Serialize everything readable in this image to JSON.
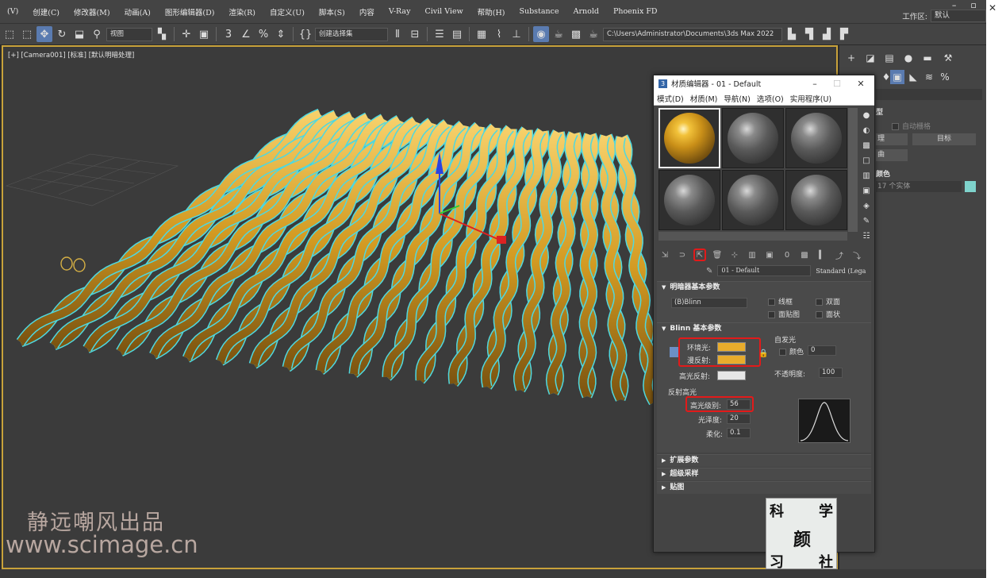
{
  "menubar": {
    "items": [
      "(V)",
      "创建(C)",
      "修改器(M)",
      "动画(A)",
      "图形编辑器(D)",
      "渲染(R)",
      "自定义(U)",
      "脚本(S)",
      "内容",
      "V-Ray",
      "Civil View",
      "帮助(H)",
      "Substance",
      "Arnold",
      "Phoenix FD"
    ],
    "workspace_label": "工作区:",
    "workspace_value": "默认"
  },
  "toolbar": {
    "view_dropdown": "视图",
    "selection_set_dropdown": "创建选择集",
    "path_dropdown": "C:\\Users\\Administrator\\Documents\\3ds Max 2022"
  },
  "viewport": {
    "label": "[+] [Camera001] [标准] [默认明暗处理]"
  },
  "command_panel": {
    "label_section": "型",
    "auto_grid": "自动栅格",
    "row1": "理",
    "target_button": "目标",
    "row2": "曲",
    "name_color": "颜色",
    "instances": "17 个实体",
    "color_swatch": "#7fd3cc"
  },
  "material_editor": {
    "window_title": "材质编辑器 - 01 - Default",
    "window_icon": "3",
    "menu": [
      "模式(D)",
      "材质(M)",
      "导航(N)",
      "选项(O)",
      "实用程序(U)"
    ],
    "material_name": "01 - Default",
    "material_type": "Standard (Lega",
    "shader_section": "明暗器基本参数",
    "shader_type": "(B)Blinn",
    "wire": "线框",
    "two_sided": "双面",
    "face_map": "面贴图",
    "faceted": "面状",
    "blinn_section": "Blinn 基本参数",
    "self_illum": "自发光",
    "color_label": "颜色",
    "color_value": "0",
    "ambient_label": "环境光:",
    "diffuse_label": "漫反射:",
    "specular_label": "高光反射:",
    "opacity_label": "不透明度:",
    "opacity_value": "100",
    "spec_highlights": "反射高光",
    "spec_level_label": "高光级别:",
    "spec_level_value": "56",
    "glossiness_label": "光泽度:",
    "glossiness_value": "20",
    "soften_label": "柔化:",
    "soften_value": "0.1",
    "extended_section": "扩展参数",
    "supersampling_section": "超级采样",
    "maps_section": "贴图",
    "ambient_color": "#e8ac2c",
    "diffuse_color": "#e8ac2c",
    "specular_color": "#e6e6e6"
  },
  "watermark": {
    "line1": "静远嘲风出品",
    "line2": "www.scimage.cn"
  },
  "logo": {
    "chars": [
      "科",
      "学",
      "颜",
      "习",
      "社"
    ]
  }
}
